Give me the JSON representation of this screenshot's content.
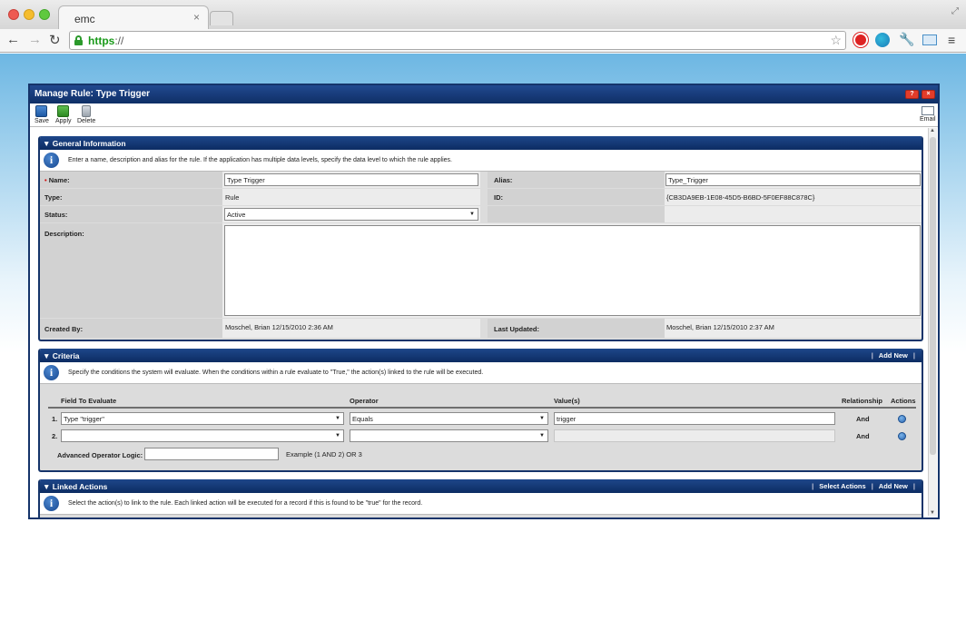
{
  "browser": {
    "tab_title": "emc",
    "tab_close": "×",
    "url_scheme": "https",
    "url_rest": "://",
    "icons": [
      "back-icon",
      "forward-icon",
      "reload-icon",
      "lock-icon",
      "star-icon",
      "extension-icon",
      "globe-icon",
      "wrench-icon",
      "screen-icon",
      "menu-icon"
    ]
  },
  "modal": {
    "title": "Manage Rule: Type Trigger",
    "help_label": "?",
    "close_label": "×",
    "toolbar": {
      "save": "Save",
      "apply": "Apply",
      "delete": "Delete",
      "email": "Email"
    }
  },
  "general": {
    "header": "▼ General Information",
    "info": "Enter a name, description and alias for the rule. If the application has multiple data levels, specify the data level to which the rule applies.",
    "name_label": "Name:",
    "name_value": "Type Trigger",
    "alias_label": "Alias:",
    "alias_value": "Type_Trigger",
    "type_label": "Type:",
    "type_value": "Rule",
    "id_label": "ID:",
    "id_value": "{CB3DA9EB-1E08-45D5-B6BD-5F0EF88C878C}",
    "status_label": "Status:",
    "status_value": "Active",
    "description_label": "Description:",
    "description_value": "",
    "created_by_label": "Created By:",
    "created_by_value": "Moschel, Brian   12/15/2010 2:36 AM",
    "last_updated_label": "Last Updated:",
    "last_updated_value": "Moschel, Brian   12/15/2010 2:37 AM"
  },
  "criteria": {
    "header": "▼ Criteria",
    "add_new": "Add New",
    "info": "Specify the conditions the system will evaluate. When the conditions within a rule evaluate to \"True,\" the action(s) linked to the rule will be executed.",
    "columns": {
      "field": "Field To Evaluate",
      "operator": "Operator",
      "values": "Value(s)",
      "relationship": "Relationship",
      "actions": "Actions"
    },
    "rows": [
      {
        "num": "1.",
        "field": "Type \"trigger\"",
        "operator": "Equals",
        "value": "trigger",
        "relationship": "And"
      },
      {
        "num": "2.",
        "field": "",
        "operator": "",
        "value": "",
        "relationship": "And"
      }
    ],
    "advanced_label": "Advanced Operator Logic:",
    "advanced_value": "",
    "example": "Example (1 AND 2) OR 3"
  },
  "linked": {
    "header": "▼ Linked Actions",
    "select_actions": "Select Actions",
    "add_new": "Add New",
    "info": "Select the action(s) to link to the rule. Each linked action will be executed for a record if this is found to be \"true\" for the record."
  }
}
